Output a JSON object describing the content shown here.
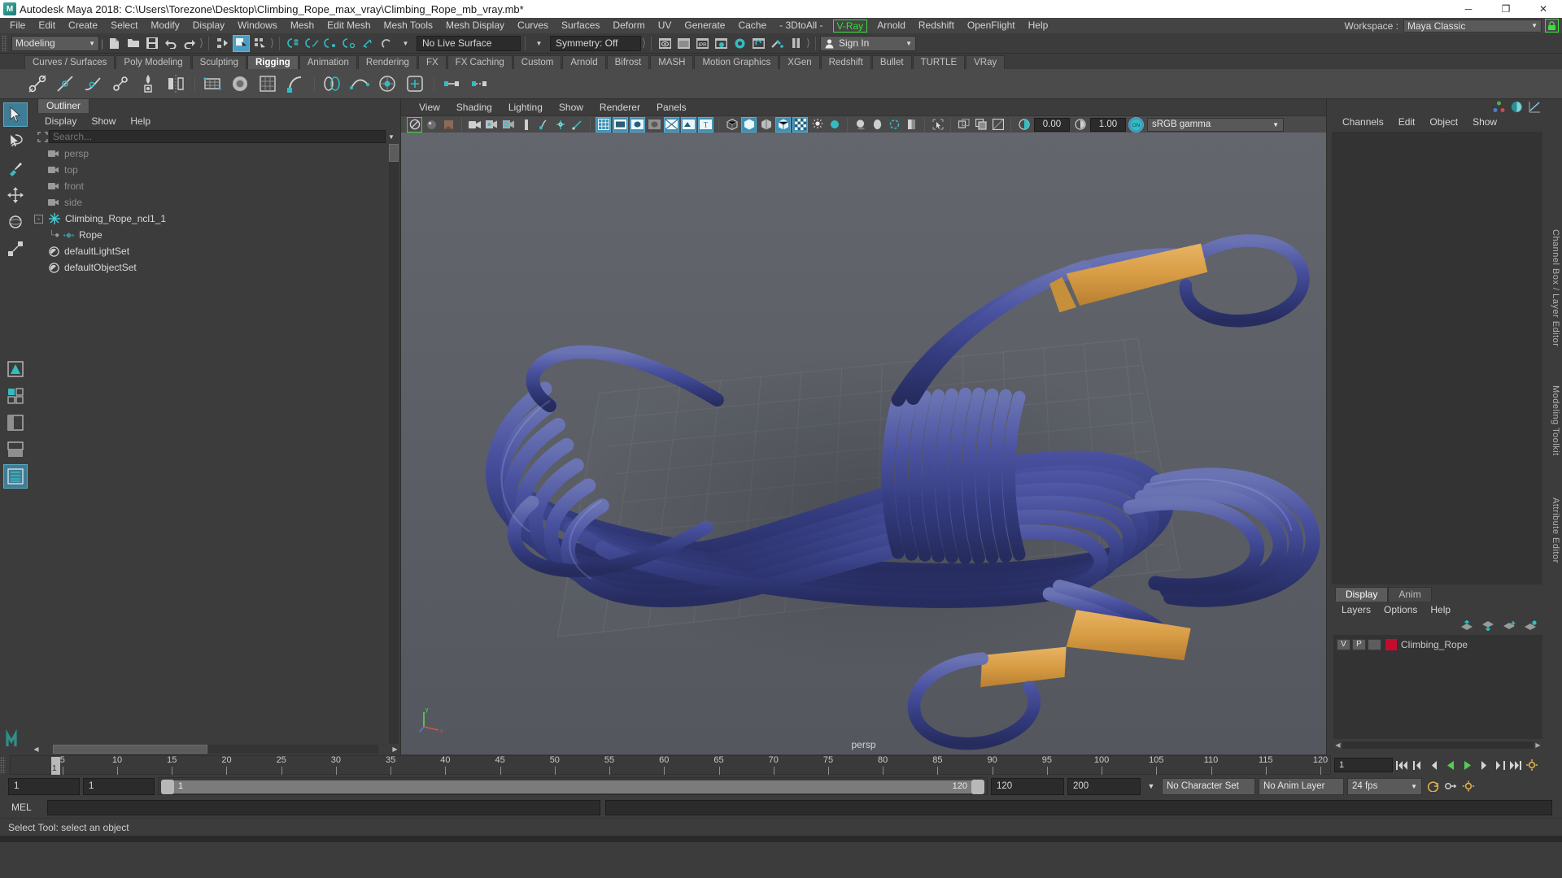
{
  "titlebar": {
    "app_title": "Autodesk Maya 2018: C:\\Users\\Torezone\\Desktop\\Climbing_Rope_max_vray\\Climbing_Rope_mb_vray.mb*",
    "logo": "maya-logo",
    "minimize": "─",
    "maximize": "❐",
    "close": "✕"
  },
  "menubar": {
    "items": [
      "File",
      "Edit",
      "Create",
      "Select",
      "Modify",
      "Display",
      "Windows",
      "Mesh",
      "Edit Mesh",
      "Mesh Tools",
      "Mesh Display",
      "Curves",
      "Surfaces",
      "Deform",
      "UV",
      "Generate",
      "Cache",
      "- 3DtoAll -"
    ],
    "vray_item": "V-Ray",
    "items_after": [
      "Arnold",
      "Redshift",
      "OpenFlight",
      "Help"
    ],
    "workspace_label": "Workspace :",
    "workspace_value": "Maya Classic",
    "lock_icon": "lock-icon"
  },
  "statusline": {
    "menuset_value": "Modeling",
    "live_surface": "No Live Surface",
    "symmetry": "Symmetry: Off",
    "signin": "Sign In"
  },
  "shelf": {
    "tabs": [
      "Curves / Surfaces",
      "Poly Modeling",
      "Sculpting",
      "Rigging",
      "Animation",
      "Rendering",
      "FX",
      "FX Caching",
      "Custom",
      "Arnold",
      "Bifrost",
      "MASH",
      "Motion Graphics",
      "XGen",
      "Redshift",
      "Bullet",
      "TURTLE",
      "VRay"
    ],
    "active_tab": "Rigging"
  },
  "outliner": {
    "tab_title": "Outliner",
    "menu": [
      "Display",
      "Show",
      "Help"
    ],
    "search_placeholder": "Search...",
    "items": [
      {
        "label": "persp",
        "icon": "camera-icon",
        "dim": true,
        "indent": 1
      },
      {
        "label": "top",
        "icon": "camera-icon",
        "dim": true,
        "indent": 1
      },
      {
        "label": "front",
        "icon": "camera-icon",
        "dim": true,
        "indent": 1
      },
      {
        "label": "side",
        "icon": "camera-icon",
        "dim": true,
        "indent": 1
      },
      {
        "label": "Climbing_Rope_ncl1_1",
        "icon": "star-node-icon",
        "dim": false,
        "indent": 0,
        "expander": "-"
      },
      {
        "label": "Rope",
        "icon": "mesh-icon",
        "dim": false,
        "indent": 2
      },
      {
        "label": "defaultLightSet",
        "icon": "set-icon",
        "dim": false,
        "indent": 1
      },
      {
        "label": "defaultObjectSet",
        "icon": "set-icon",
        "dim": false,
        "indent": 1
      }
    ]
  },
  "viewport": {
    "menu": [
      "View",
      "Shading",
      "Lighting",
      "Show",
      "Renderer",
      "Panels"
    ],
    "exposure_value": "0.00",
    "gamma_value": "1.00",
    "color_profile": "sRGB gamma",
    "camera_label": "persp",
    "axis": {
      "x": "x",
      "y": "y",
      "z": "z"
    },
    "scene_description": "3D rendering of a coiled blue and purple climbing rope with tan/orange sleeve wraps on a grey ground grid"
  },
  "channelbox": {
    "menu": [
      "Channels",
      "Edit",
      "Object",
      "Show"
    ],
    "side_label": "Channel Box / Layer Editor",
    "icons": [
      "channel-box-icon",
      "attribute-editor-icon",
      "graph-editor-icon"
    ],
    "right_tabs": [
      "Channel Box / Layer Editor",
      "Modeling Toolkit",
      "Attribute Editor"
    ]
  },
  "layereditor": {
    "tabs": [
      "Display",
      "Anim"
    ],
    "active_tab": "Display",
    "menu": [
      "Layers",
      "Options",
      "Help"
    ],
    "buttons": [
      "move-layer-up-icon",
      "move-layer-down-icon",
      "new-layer-icon",
      "new-layer-from-selected-icon"
    ],
    "layers": [
      {
        "visible": "V",
        "playback": "P",
        "shading": "",
        "color": "#c40d2e",
        "name": "Climbing_Rope"
      }
    ]
  },
  "timeslider": {
    "current_frame": "1",
    "ticks": [
      5,
      10,
      15,
      20,
      25,
      30,
      35,
      40,
      45,
      50,
      55,
      60,
      65,
      70,
      75,
      80,
      85,
      90,
      95,
      100,
      105,
      110,
      115,
      120
    ],
    "start": 1,
    "end": 120,
    "playback_buttons": [
      "go-to-start-icon",
      "step-back-key-icon",
      "step-back-frame-icon",
      "play-backwards-icon",
      "play-forwards-icon",
      "step-forward-frame-icon",
      "step-forward-key-icon",
      "go-to-end-icon"
    ],
    "frame_field": "1"
  },
  "rangeslider": {
    "anim_start": "1",
    "playback_start": "1",
    "bar_start_label": "1",
    "bar_end_label": "120",
    "playback_end": "120",
    "anim_end": "200",
    "character_set": "No Character Set",
    "anim_layer": "No Anim Layer",
    "fps": "24 fps",
    "loop_icon": "loop-icon",
    "key_icon": "auto-key-icon",
    "prefs_icon": "animation-preferences-icon"
  },
  "commandline": {
    "mel_label": "MEL",
    "input_value": ""
  },
  "helpline": {
    "text": "Select Tool: select an object"
  },
  "colors": {
    "accent_blue": "#4a9ec4",
    "accent_teal": "#33bcc4",
    "vray_green": "#3ddc3d",
    "layer_red": "#c40d2e",
    "viewport_bg": "#5c5f66",
    "rope_blue": "#3d4a8c",
    "rope_tan": "#d9a049"
  }
}
